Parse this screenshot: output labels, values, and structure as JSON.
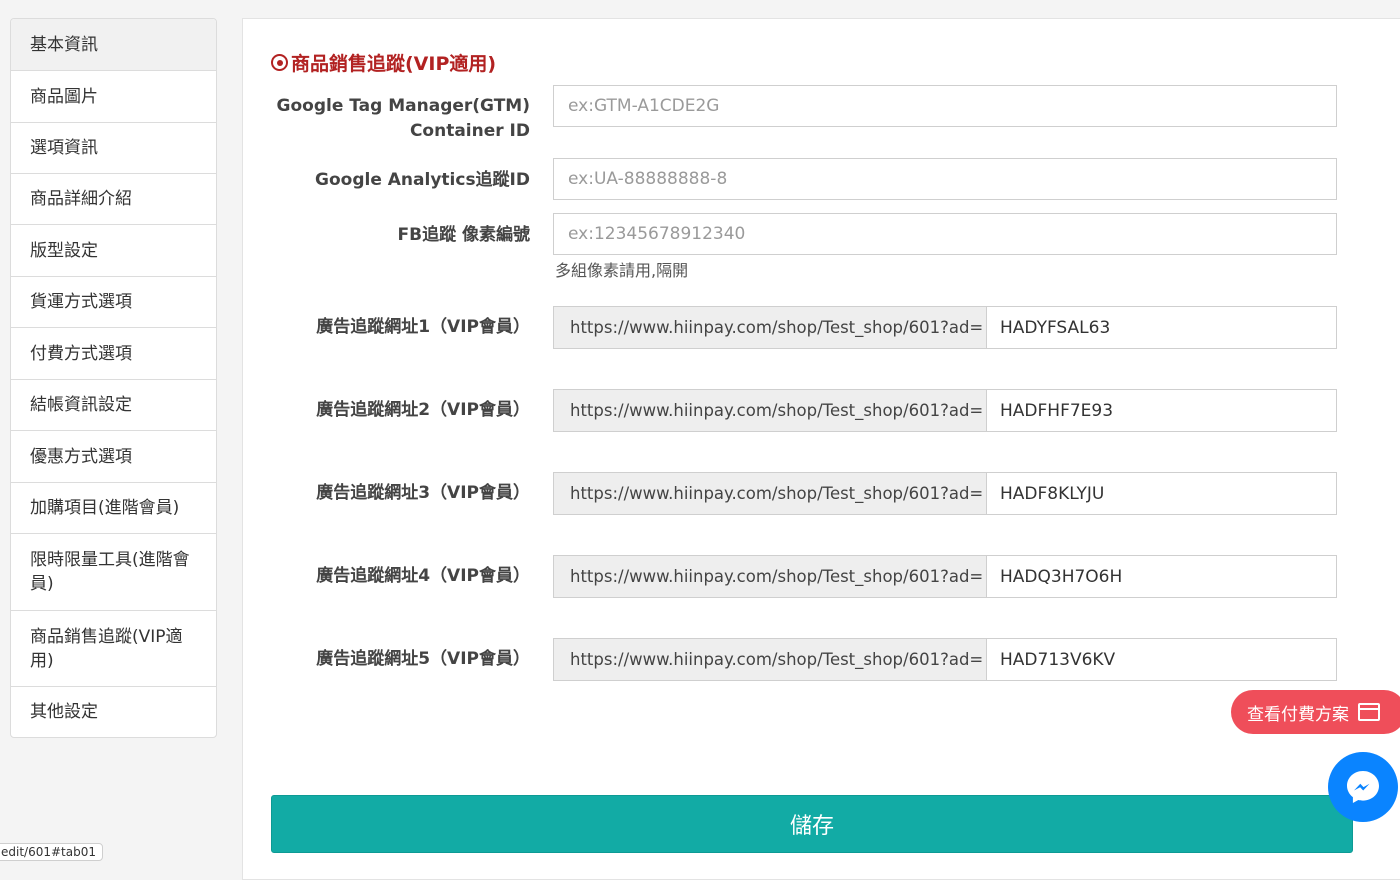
{
  "sidebar": {
    "items": [
      {
        "label": "基本資訊"
      },
      {
        "label": "商品圖片"
      },
      {
        "label": "選項資訊"
      },
      {
        "label": "商品詳細介紹"
      },
      {
        "label": "版型設定"
      },
      {
        "label": "貨運方式選項"
      },
      {
        "label": "付費方式選項"
      },
      {
        "label": "結帳資訊設定"
      },
      {
        "label": "優惠方式選項"
      },
      {
        "label": "加購項目(進階會員)"
      },
      {
        "label": "限時限量工具(進階會員)"
      },
      {
        "label": "商品銷售追蹤(VIP適用)"
      },
      {
        "label": "其他設定"
      }
    ]
  },
  "main": {
    "section_title": "商品銷售追蹤(VIP適用)",
    "gtm": {
      "label": "Google Tag Manager(GTM)\nContainer ID",
      "placeholder": "ex:GTM-A1CDE2G"
    },
    "ga": {
      "label": "Google Analytics追蹤ID",
      "placeholder": "ex:UA-88888888-8"
    },
    "fb": {
      "label": "FB追蹤 像素編號",
      "placeholder": "ex:12345678912340",
      "help": "多組像素請用,隔開"
    },
    "ad_urls": [
      {
        "label": "廣告追蹤網址1（VIP會員）",
        "prefix": "https://www.hiinpay.com/shop/Test_shop/601?ad=",
        "value": "HADYFSAL63"
      },
      {
        "label": "廣告追蹤網址2（VIP會員）",
        "prefix": "https://www.hiinpay.com/shop/Test_shop/601?ad=",
        "value": "HADFHF7E93"
      },
      {
        "label": "廣告追蹤網址3（VIP會員）",
        "prefix": "https://www.hiinpay.com/shop/Test_shop/601?ad=",
        "value": "HADF8KLYJU"
      },
      {
        "label": "廣告追蹤網址4（VIP會員）",
        "prefix": "https://www.hiinpay.com/shop/Test_shop/601?ad=",
        "value": "HADQ3H7O6H"
      },
      {
        "label": "廣告追蹤網址5（VIP會員）",
        "prefix": "https://www.hiinpay.com/shop/Test_shop/601?ad=",
        "value": "HAD713V6KV"
      }
    ],
    "save_label": "儲存"
  },
  "floating": {
    "plan_label": "查看付費方案",
    "plan_icon": "credit-card-icon",
    "messenger_icon": "messenger-icon"
  },
  "status_url": "edit/601#tab01",
  "colors": {
    "save": "#12aba5",
    "plan": "#ef4e5a",
    "messenger": "#0a84ff",
    "title": "#b22222"
  }
}
